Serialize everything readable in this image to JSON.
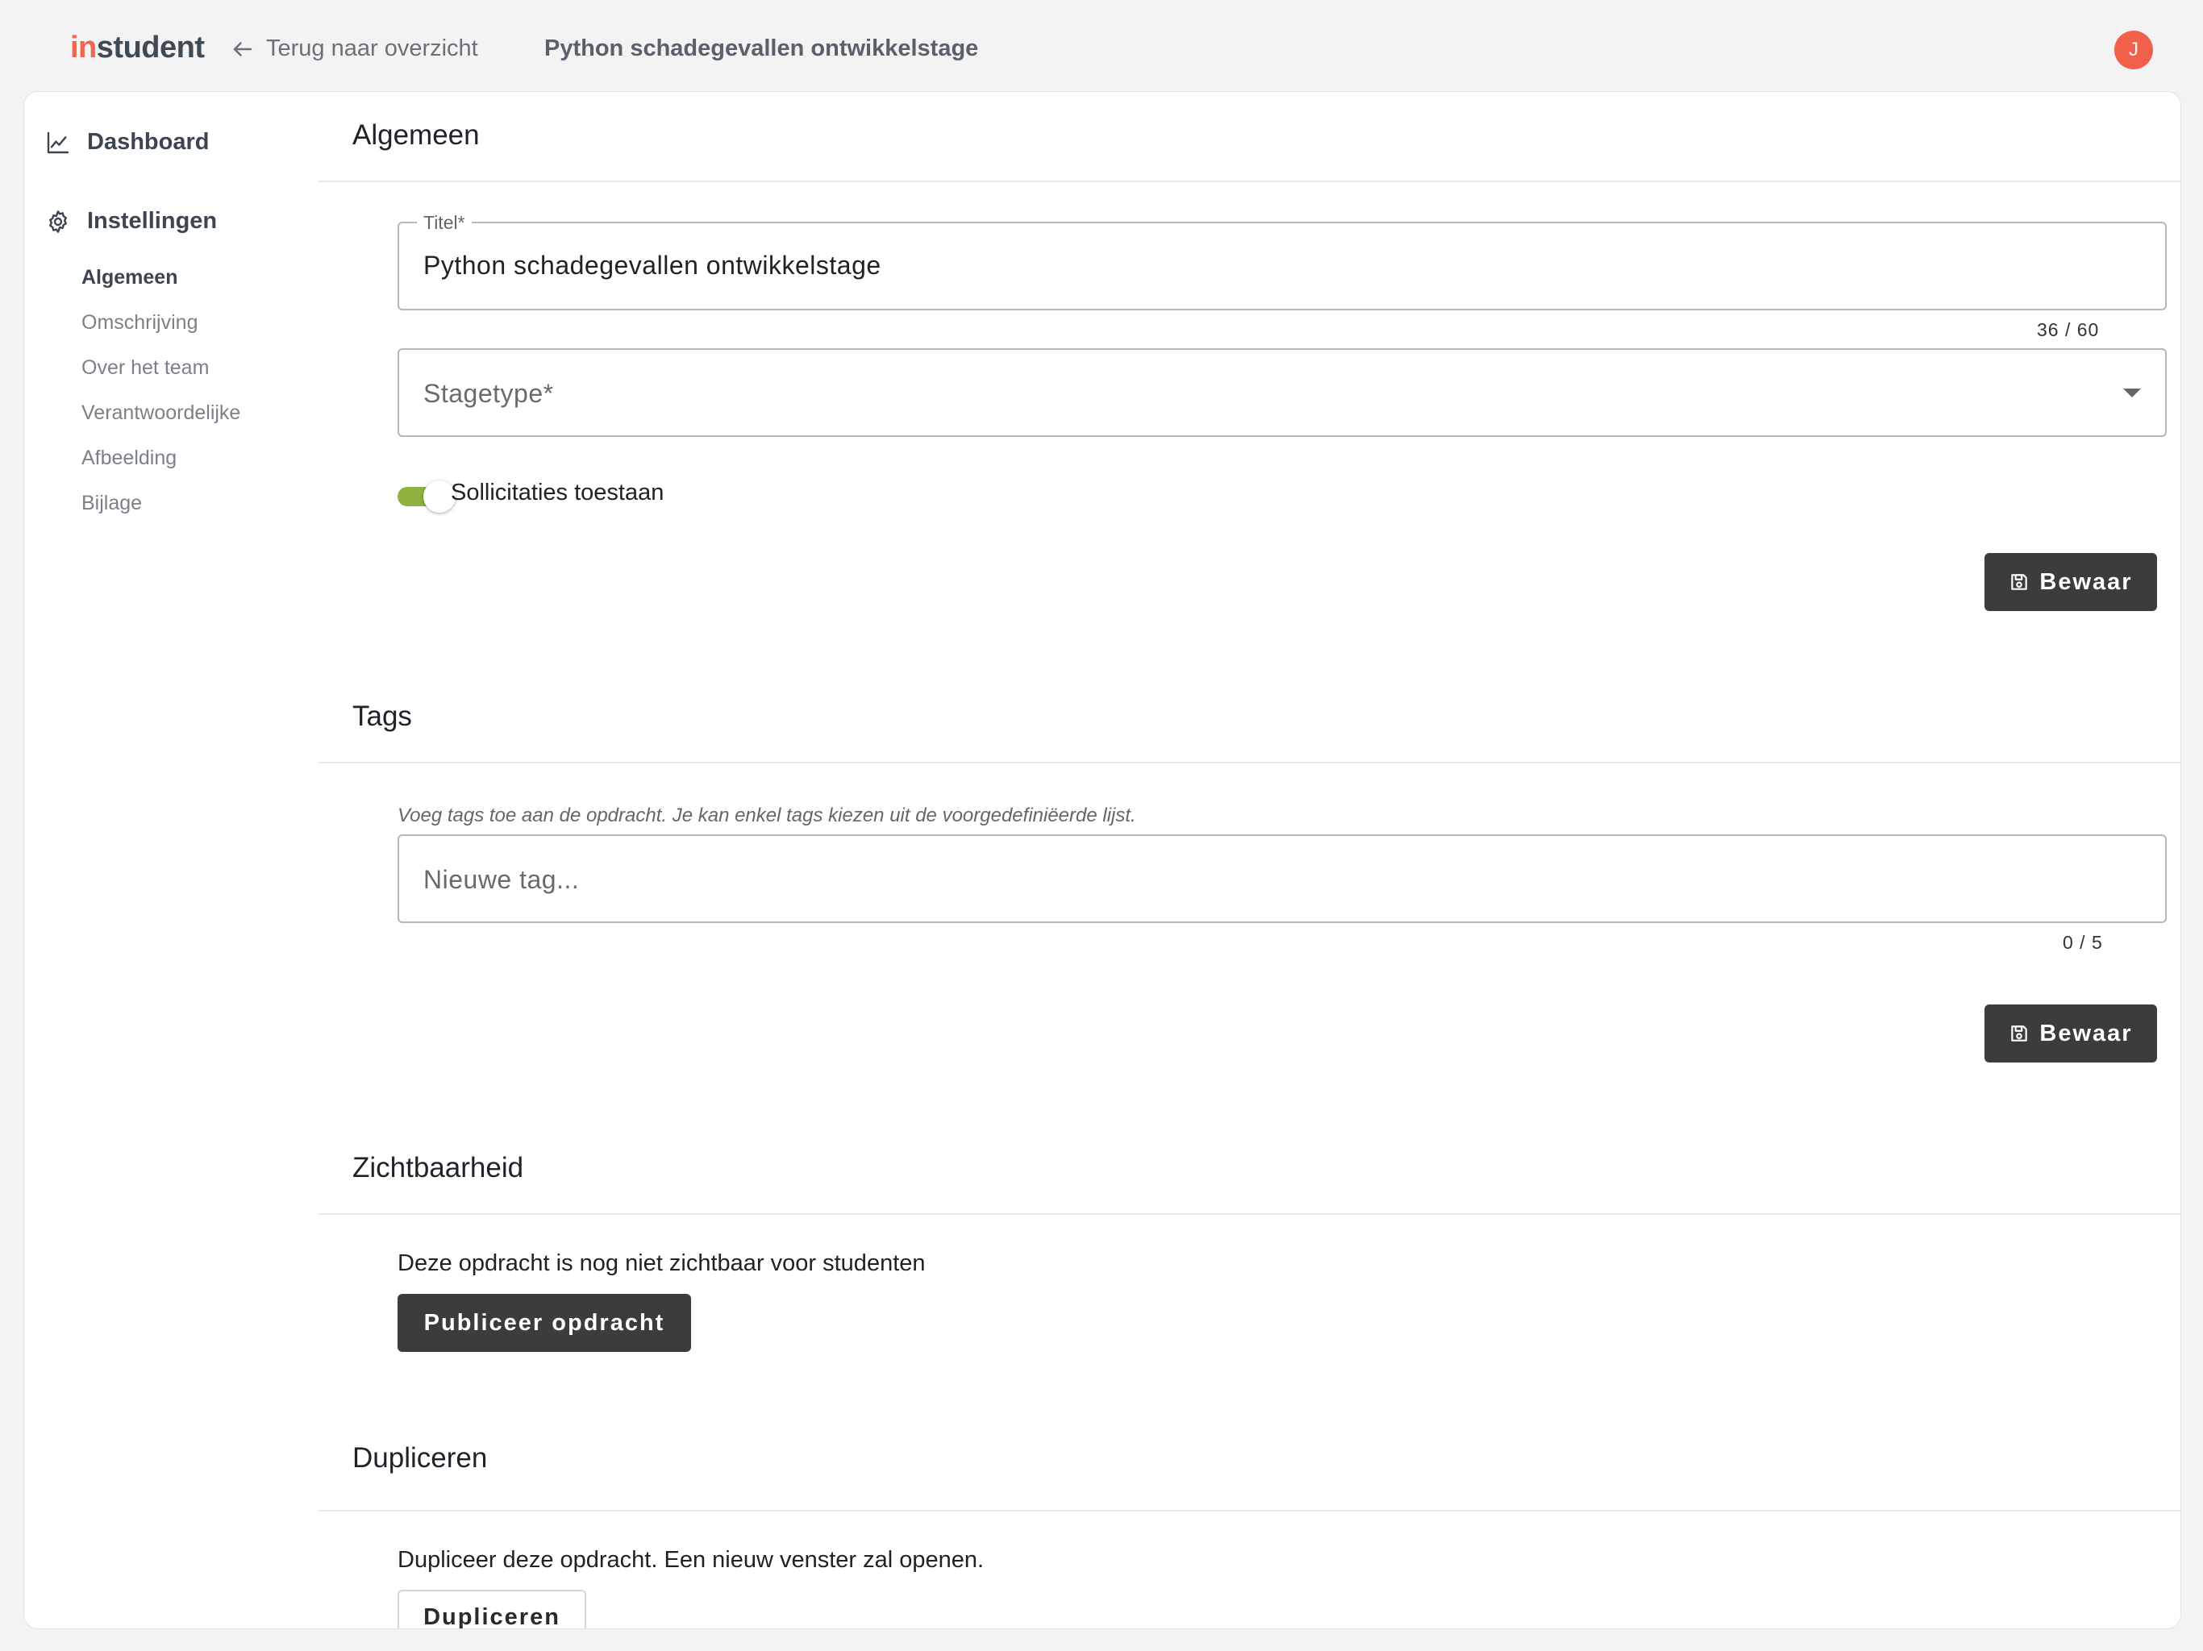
{
  "header": {
    "logo_prefix": "in",
    "logo_suffix": "student",
    "back_label": "Terug naar overzicht",
    "page_title": "Python schadegevallen ontwikkelstage",
    "avatar_initial": "J"
  },
  "sidebar": {
    "dashboard": "Dashboard",
    "settings": "Instellingen",
    "items": [
      "Algemeen",
      "Omschrijving",
      "Over het team",
      "Verantwoordelijke",
      "Afbeelding",
      "Bijlage"
    ],
    "active_item": "Algemeen"
  },
  "general": {
    "title": "Algemeen",
    "title_field_label": "Titel*",
    "title_field_value": "Python schadegevallen ontwikkelstage",
    "title_counter": "36 / 60",
    "stagetype_placeholder": "Stagetype*",
    "toggle_label": "Sollicitaties toestaan",
    "toggle_on": true,
    "save_label": "Bewaar"
  },
  "tags": {
    "title": "Tags",
    "hint": "Voeg tags toe aan de opdracht. Je kan enkel tags kiezen uit de voorgedefiniëerde lijst.",
    "placeholder": "Nieuwe tag...",
    "counter": "0 / 5",
    "save_label": "Bewaar"
  },
  "visibility": {
    "title": "Zichtbaarheid",
    "text": "Deze opdracht is nog niet zichtbaar voor studenten",
    "publish_label": "Publiceer opdracht"
  },
  "duplicate": {
    "title": "Dupliceren",
    "text": "Dupliceer deze opdracht. Een nieuw venster zal openen.",
    "button_label": "Dupliceren"
  },
  "colors": {
    "brand_accent": "#f0654f",
    "toggle_on": "#8fb33e",
    "button_dark": "#3c3c3c"
  }
}
